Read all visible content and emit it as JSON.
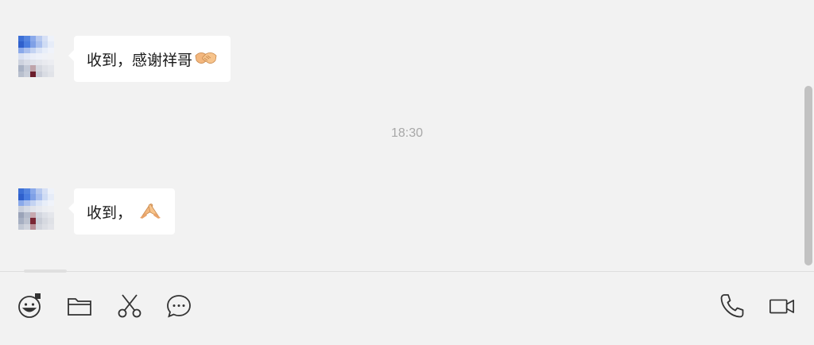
{
  "messages": [
    {
      "text": "收到，感谢祥哥",
      "emoji": "handshake-emoji"
    },
    {
      "text": "收到，",
      "emoji": "pray-emoji"
    }
  ],
  "timestamp": "18:30",
  "toolbar": {
    "left_icons": [
      "emoji-icon",
      "folder-icon",
      "scissors-icon",
      "chat-bubble-icon"
    ],
    "right_icons": [
      "phone-icon",
      "video-camera-icon"
    ]
  }
}
